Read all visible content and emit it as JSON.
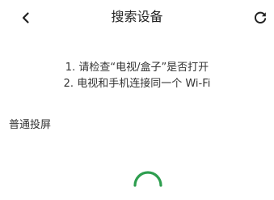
{
  "header": {
    "title": "搜索设备"
  },
  "tips": [
    "1. 请检查“电视/盒子”是否打开",
    "2. 电视和手机连接同一个 Wi-Fi"
  ],
  "section": {
    "label": "普通投屏"
  },
  "colors": {
    "accent": "#2e9e4f",
    "text": "#222222",
    "background": "#ffffff"
  },
  "icons": {
    "back": "chevron-left-icon",
    "refresh": "refresh-icon",
    "loading": "loading-spinner-icon"
  }
}
